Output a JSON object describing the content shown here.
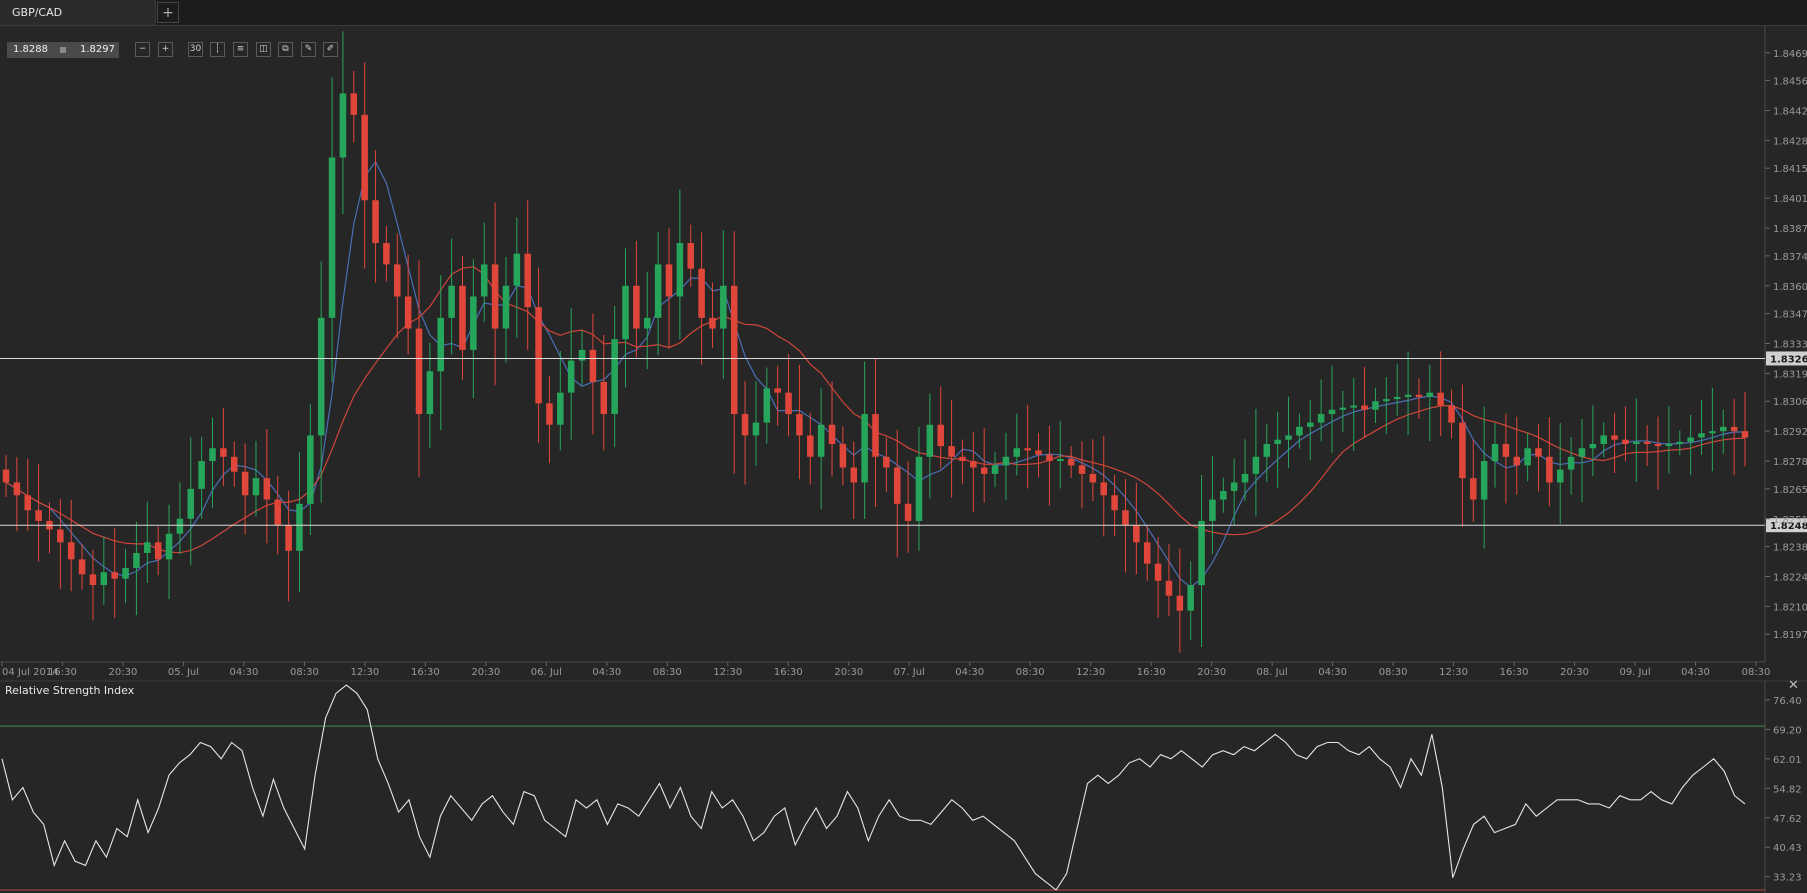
{
  "tab": {
    "title": "GBP/CAD",
    "add_label": "+"
  },
  "quote": {
    "bid": "1.8288",
    "ask": "1.8297"
  },
  "toolbar": {
    "tools": [
      {
        "name": "zoom-out-icon",
        "glyph": "−"
      },
      {
        "name": "zoom-in-icon",
        "glyph": "+"
      },
      {
        "name": "timeframe-30m-icon",
        "glyph": "30"
      },
      {
        "name": "candlestick-type-icon",
        "glyph": "┆"
      },
      {
        "name": "indicators-icon",
        "glyph": "≡"
      },
      {
        "name": "chart-settings-icon",
        "glyph": "◫"
      },
      {
        "name": "copy-icon",
        "glyph": "⧉"
      },
      {
        "name": "edit-icon",
        "glyph": "✎"
      },
      {
        "name": "draw-icon",
        "glyph": "✐"
      }
    ]
  },
  "chart_data": [
    {
      "type": "candlestick",
      "symbol": "GBP/CAD",
      "y_ticks": [
        "1.8469",
        "1.8456",
        "1.8442",
        "1.8428",
        "1.8415",
        "1.8401",
        "1.8387",
        "1.8374",
        "1.8360",
        "1.8347",
        "1.8333",
        "1.8319",
        "1.8306",
        "1.8292",
        "1.8278",
        "1.8265",
        "1.8251",
        "1.8238",
        "1.8224",
        "1.8210",
        "1.8197"
      ],
      "ylim": [
        1.8184,
        1.8482
      ],
      "x_ticks": [
        "04 Jul 2014",
        "16:30",
        "20:30",
        "05. Jul",
        "04:30",
        "08:30",
        "12:30",
        "16:30",
        "20:30",
        "06. Jul",
        "04:30",
        "08:30",
        "12:30",
        "16:30",
        "20:30",
        "07. Jul",
        "04:30",
        "08:30",
        "12:30",
        "16:30",
        "20:30",
        "08. Jul",
        "04:30",
        "08:30",
        "12:30",
        "16:30",
        "20:30",
        "09. Jul",
        "04:30",
        "08:30"
      ],
      "horizontal_lines": [
        {
          "value": 1.8326,
          "label": "1.8326"
        },
        {
          "value": 1.8248,
          "label": "1.8248"
        }
      ],
      "series": [
        {
          "name": "",
          "kind": "close",
          "color_up": "#26a65b",
          "color_down": "#e0473a",
          "values": [
            1.8268,
            1.8262,
            1.8255,
            1.825,
            1.8246,
            1.824,
            1.8232,
            1.8225,
            1.822,
            1.8226,
            1.8223,
            1.8228,
            1.8235,
            1.824,
            1.8232,
            1.8244,
            1.8251,
            1.8265,
            1.8278,
            1.8284,
            1.828,
            1.8273,
            1.8262,
            1.827,
            1.826,
            1.8248,
            1.8236,
            1.8258,
            1.829,
            1.8345,
            1.842,
            1.845,
            1.844,
            1.84,
            1.838,
            1.837,
            1.8355,
            1.834,
            1.83,
            1.832,
            1.8345,
            1.836,
            1.833,
            1.8355,
            1.837,
            1.834,
            1.836,
            1.8375,
            1.835,
            1.8305,
            1.8295,
            1.831,
            1.8325,
            1.833,
            1.8315,
            1.83,
            1.8335,
            1.836,
            1.834,
            1.8345,
            1.837,
            1.8355,
            1.838,
            1.8368,
            1.8345,
            1.834,
            1.836,
            1.83,
            1.829,
            1.8296,
            1.8312,
            1.831,
            1.83,
            1.829,
            1.828,
            1.8295,
            1.8286,
            1.8275,
            1.8268,
            1.83,
            1.828,
            1.8275,
            1.8258,
            1.825,
            1.828,
            1.8295,
            1.8285,
            1.828,
            1.8278,
            1.8275,
            1.8272,
            1.8276,
            1.828,
            1.8284,
            1.8283,
            1.8281,
            1.8278,
            1.8279,
            1.8276,
            1.8272,
            1.8268,
            1.8262,
            1.8255,
            1.8248,
            1.824,
            1.823,
            1.8222,
            1.8215,
            1.8208,
            1.822,
            1.825,
            1.826,
            1.8264,
            1.8268,
            1.8272,
            1.828,
            1.8286,
            1.8288,
            1.829,
            1.8294,
            1.8296,
            1.83,
            1.8302,
            1.8303,
            1.8304,
            1.8302,
            1.8306,
            1.8307,
            1.8308,
            1.8309,
            1.8308,
            1.831,
            1.8304,
            1.8296,
            1.827,
            1.826,
            1.8278,
            1.8286,
            1.828,
            1.8276,
            1.8284,
            1.828,
            1.8268,
            1.8274,
            1.828,
            1.8284,
            1.8286,
            1.829,
            1.8288,
            1.8286,
            1.8287,
            1.8286,
            1.8285,
            1.8286,
            1.8287,
            1.8289,
            1.8291,
            1.8292,
            1.8294,
            1.8292,
            1.8289
          ]
        }
      ],
      "moving_averages": [
        {
          "name": "",
          "color": "#4a6fb5",
          "period": 5
        },
        {
          "name": "",
          "color": "#d0453a",
          "period": 14
        }
      ]
    },
    {
      "type": "line",
      "title": "Relative Strength Index",
      "y_ticks": [
        "76.40",
        "69.20",
        "62.01",
        "54.82",
        "47.62",
        "40.43",
        "33.23"
      ],
      "ylim": [
        29.5,
        81.0
      ],
      "levels": [
        {
          "value": 70,
          "color": "#3f8f4a"
        },
        {
          "value": 30,
          "color": "#b8483d"
        }
      ],
      "series": [
        {
          "name": "",
          "color": "#e6e6e6",
          "values": [
            62,
            52,
            55,
            49,
            46,
            36,
            42,
            37,
            36,
            42,
            38,
            45,
            43,
            52,
            44,
            50,
            58,
            61,
            63,
            66,
            65,
            62,
            66,
            64,
            55,
            48,
            57,
            50,
            45,
            40,
            58,
            72,
            78,
            80,
            78,
            74,
            62,
            56,
            49,
            52,
            43,
            38,
            48,
            53,
            50,
            47,
            51,
            53,
            49,
            46,
            54,
            53,
            47,
            45,
            43,
            52,
            50,
            52,
            46,
            51,
            50,
            48,
            52,
            56,
            50,
            55,
            48,
            45,
            54,
            50,
            52,
            48,
            42,
            44,
            48,
            50,
            41,
            46,
            50,
            45,
            48,
            54,
            50,
            42,
            48,
            52,
            48,
            47,
            47,
            46,
            49,
            52,
            50,
            47,
            48,
            46,
            44,
            42,
            38,
            34,
            32,
            30,
            34,
            45,
            56,
            58,
            56,
            58,
            61,
            62,
            60,
            63,
            62,
            64,
            62,
            60,
            63,
            64,
            63,
            65,
            64,
            66,
            68,
            66,
            63,
            62,
            65,
            66,
            66,
            64,
            63,
            65,
            62,
            60,
            55,
            62,
            58,
            68,
            55,
            33,
            40,
            46,
            48,
            44,
            45,
            46,
            51,
            48,
            50,
            52,
            52,
            52,
            51,
            51,
            50,
            53,
            52,
            52,
            54,
            52,
            51,
            55,
            58,
            60,
            62,
            59,
            53,
            51
          ]
        }
      ]
    }
  ]
}
